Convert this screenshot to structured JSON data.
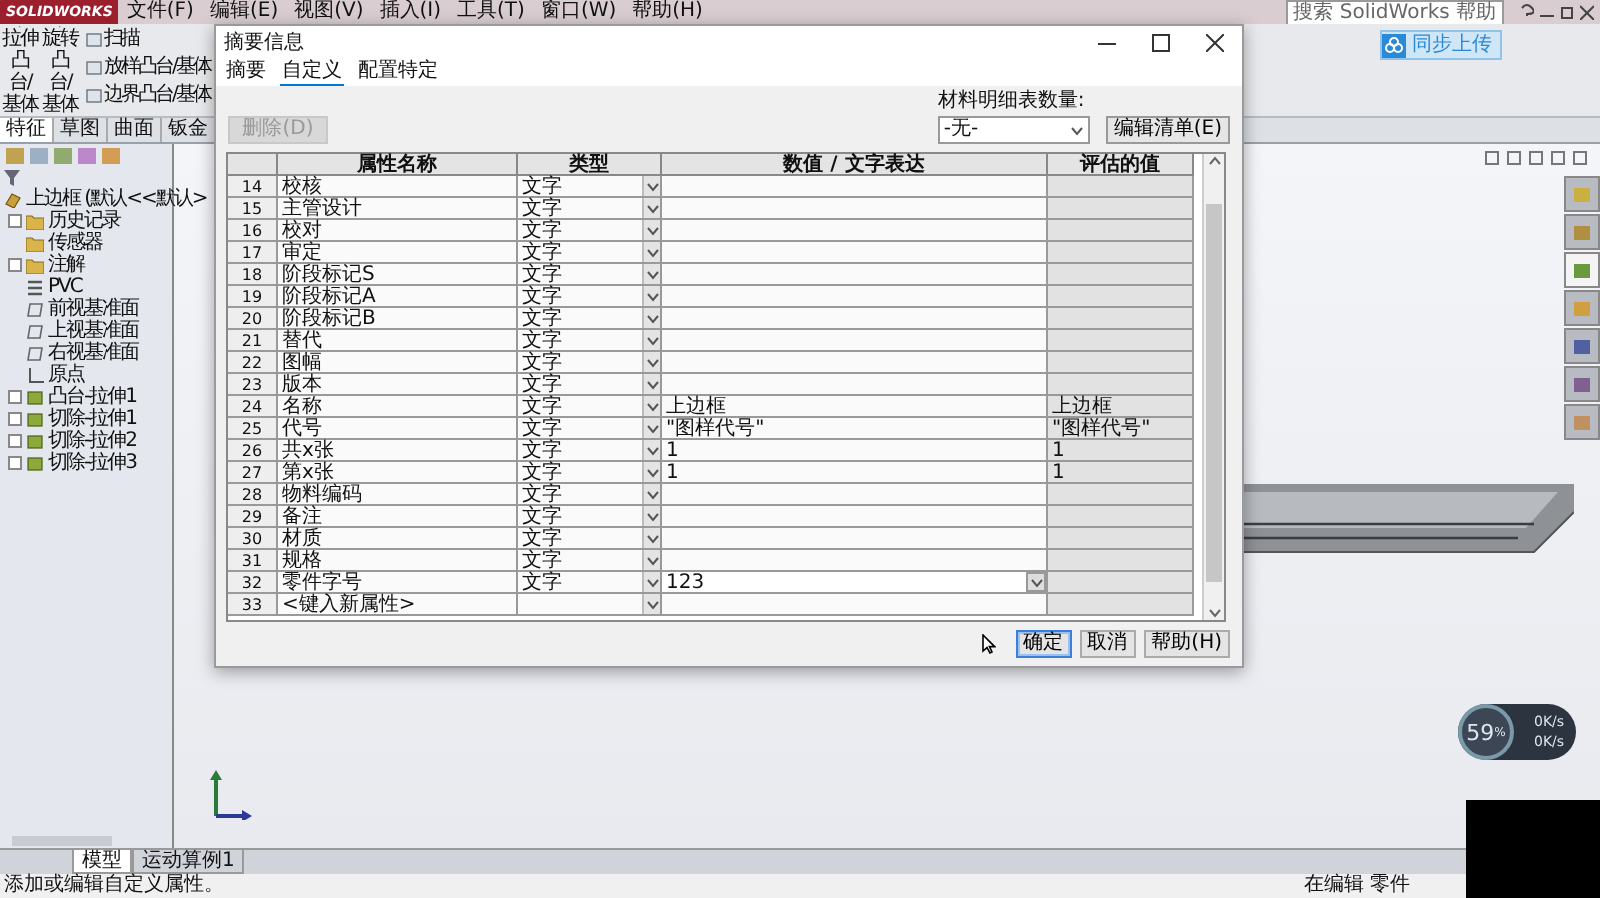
{
  "menu_bar": {
    "logo": "SOLIDWORKS",
    "items": [
      "文件(F)",
      "编辑(E)",
      "视图(V)",
      "插入(I)",
      "工具(T)",
      "窗口(W)",
      "帮助(H)"
    ],
    "search": {
      "placeholder": "搜索 SolidWorks 帮助"
    }
  },
  "sync_button": "同步上传",
  "command_manager": {
    "large_buttons": [
      "拉伸凸台/基体",
      "旋转凸台/基体"
    ],
    "small_buttons": [
      "扫描",
      "放样凸台/基体",
      "边界凸台/基体"
    ],
    "tabs": [
      {
        "label": "特征",
        "selected": true
      },
      {
        "label": "草图",
        "selected": false
      },
      {
        "label": "曲面",
        "selected": false
      },
      {
        "label": "钣金",
        "selected": false
      }
    ]
  },
  "feature_tree": {
    "root": "上边框 (默认<<默认>",
    "children": [
      {
        "label": "历史记录",
        "kind": "folder",
        "expandable": true
      },
      {
        "label": "传感器",
        "kind": "folder",
        "expandable": false
      },
      {
        "label": "注解",
        "kind": "folder",
        "expandable": true
      },
      {
        "label": "PVC",
        "kind": "material",
        "expandable": false
      },
      {
        "label": "前视基准面",
        "kind": "plane",
        "expandable": false
      },
      {
        "label": "上视基准面",
        "kind": "plane",
        "expandable": false
      },
      {
        "label": "右视基准面",
        "kind": "plane",
        "expandable": false
      },
      {
        "label": "原点",
        "kind": "origin",
        "expandable": false
      },
      {
        "label": "凸台-拉伸1",
        "kind": "feature",
        "expandable": true
      },
      {
        "label": "切除-拉伸1",
        "kind": "feature",
        "expandable": true
      },
      {
        "label": "切除-拉伸2",
        "kind": "feature",
        "expandable": true
      },
      {
        "label": "切除-拉伸3",
        "kind": "feature",
        "expandable": true
      }
    ]
  },
  "dialog": {
    "title": "摘要信息",
    "tabs": [
      {
        "label": "摘要",
        "selected": false
      },
      {
        "label": "自定义",
        "selected": true
      },
      {
        "label": "配置特定",
        "selected": false
      }
    ],
    "delete_button": {
      "label": "删除(D)",
      "disabled": true
    },
    "bom_quantity": {
      "label": "材料明细表数量:",
      "value": "-无-"
    },
    "edit_list_button": "编辑清单(E)",
    "table": {
      "columns": [
        "属性名称",
        "类型",
        "数值 / 文字表达",
        "评估的值"
      ],
      "rows": [
        {
          "number": "14",
          "name": "校核",
          "type": "文字",
          "kind": "property",
          "editing": false
        },
        {
          "number": "15",
          "name": "主管设计",
          "type": "文字",
          "kind": "property",
          "editing": false
        },
        {
          "number": "16",
          "name": "校对",
          "type": "文字",
          "kind": "property",
          "editing": false
        },
        {
          "number": "17",
          "name": "审定",
          "type": "文字",
          "kind": "property",
          "editing": false
        },
        {
          "number": "18",
          "name": "阶段标记S",
          "type": "文字",
          "kind": "property",
          "editing": false
        },
        {
          "number": "19",
          "name": "阶段标记A",
          "type": "文字",
          "kind": "property",
          "editing": false
        },
        {
          "number": "20",
          "name": "阶段标记B",
          "type": "文字",
          "kind": "property",
          "editing": false
        },
        {
          "number": "21",
          "name": "替代",
          "type": "文字",
          "kind": "property",
          "editing": false
        },
        {
          "number": "22",
          "name": "图幅",
          "type": "文字",
          "kind": "property",
          "editing": false
        },
        {
          "number": "23",
          "name": "版本",
          "type": "文字",
          "kind": "property",
          "editing": false
        },
        {
          "number": "24",
          "name": "名称",
          "type": "文字",
          "value": "上边框",
          "evaluated": "上边框",
          "kind": "property",
          "editing": false
        },
        {
          "number": "25",
          "name": "代号",
          "type": "文字",
          "value": "\"图样代号\"",
          "evaluated": "\"图样代号\"",
          "kind": "property",
          "editing": false
        },
        {
          "number": "26",
          "name": "共x张",
          "type": "文字",
          "value": "1",
          "evaluated": "1",
          "kind": "property",
          "editing": false
        },
        {
          "number": "27",
          "name": "第x张",
          "type": "文字",
          "value": "1",
          "evaluated": "1",
          "kind": "property",
          "editing": false
        },
        {
          "number": "28",
          "name": "物料编码",
          "type": "文字",
          "kind": "property",
          "editing": false
        },
        {
          "number": "29",
          "name": "备注",
          "type": "文字",
          "kind": "property",
          "editing": false
        },
        {
          "number": "30",
          "name": "材质",
          "type": "文字",
          "kind": "property",
          "editing": false
        },
        {
          "number": "31",
          "name": "规格",
          "type": "文字",
          "kind": "property",
          "editing": false
        },
        {
          "number": "32",
          "name": "零件字号",
          "type": "文字",
          "value": "123",
          "kind": "property",
          "editing": true
        },
        {
          "number": "33",
          "name": "<键入新属性>",
          "kind": "new",
          "editing": false
        }
      ]
    },
    "buttons": [
      {
        "label": "确定",
        "default": true
      },
      {
        "label": "取消",
        "default": false
      },
      {
        "label": "帮助(H)",
        "default": false
      }
    ]
  },
  "bottom_tabs": [
    {
      "label": "模型",
      "selected": true
    },
    {
      "label": "运动算例1",
      "selected": false
    }
  ],
  "status_bar": {
    "message": "添加或编辑自定义属性。",
    "mode": "在编辑 零件"
  },
  "network_widget": {
    "percent": "59",
    "unit": "%",
    "upload": "0K/s",
    "download": "0K/s"
  }
}
